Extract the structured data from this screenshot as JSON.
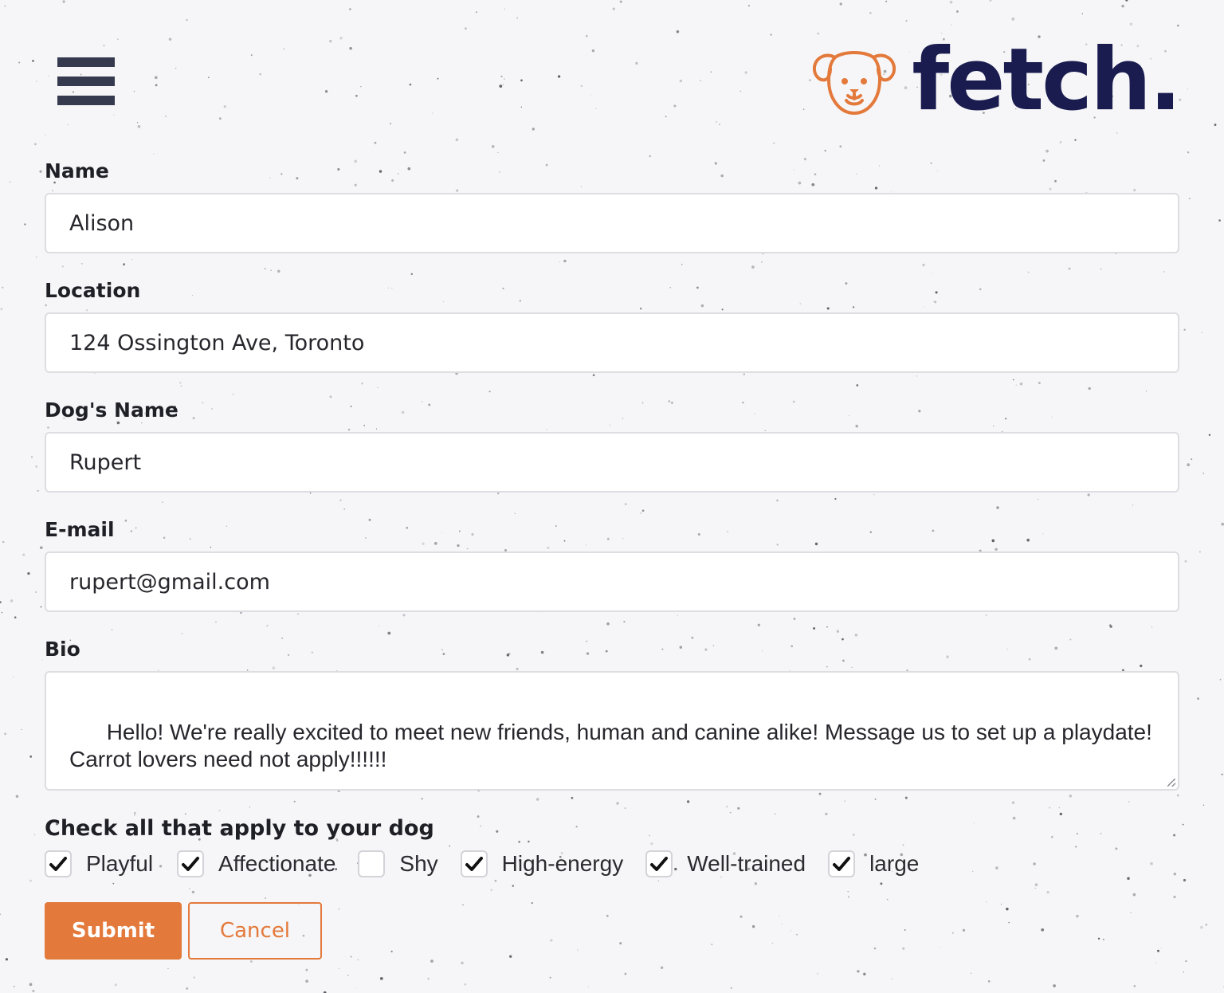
{
  "header": {
    "menu_icon": "hamburger-menu-icon",
    "logo_icon": "dog-face-icon",
    "brand_name": "fetch."
  },
  "form": {
    "fields": [
      {
        "label": "Name",
        "value": "Alison"
      },
      {
        "label": "Location",
        "value": "124 Ossington Ave, Toronto"
      },
      {
        "label": "Dog's Name",
        "value": "Rupert"
      },
      {
        "label": "E-mail",
        "value": "rupert@gmail.com"
      }
    ],
    "bio": {
      "label": "Bio",
      "value": "Hello! We're really excited to meet new friends, human and canine alike! Message us to set up a playdate! Carrot lovers need not apply!!!!!!"
    },
    "traits": {
      "title": "Check all that apply to your dog",
      "options": [
        {
          "label": "Playful",
          "checked": true
        },
        {
          "label": "Affectionate",
          "checked": true
        },
        {
          "label": "Shy",
          "checked": false
        },
        {
          "label": "High-energy",
          "checked": true
        },
        {
          "label": "Well-trained",
          "checked": true
        },
        {
          "label": "large",
          "checked": true
        }
      ]
    },
    "submit_label": "Submit",
    "cancel_label": "Cancel"
  },
  "colors": {
    "accent": "#e3793a",
    "brand_navy": "#1a1c4f",
    "background": "#f6f6f8"
  }
}
